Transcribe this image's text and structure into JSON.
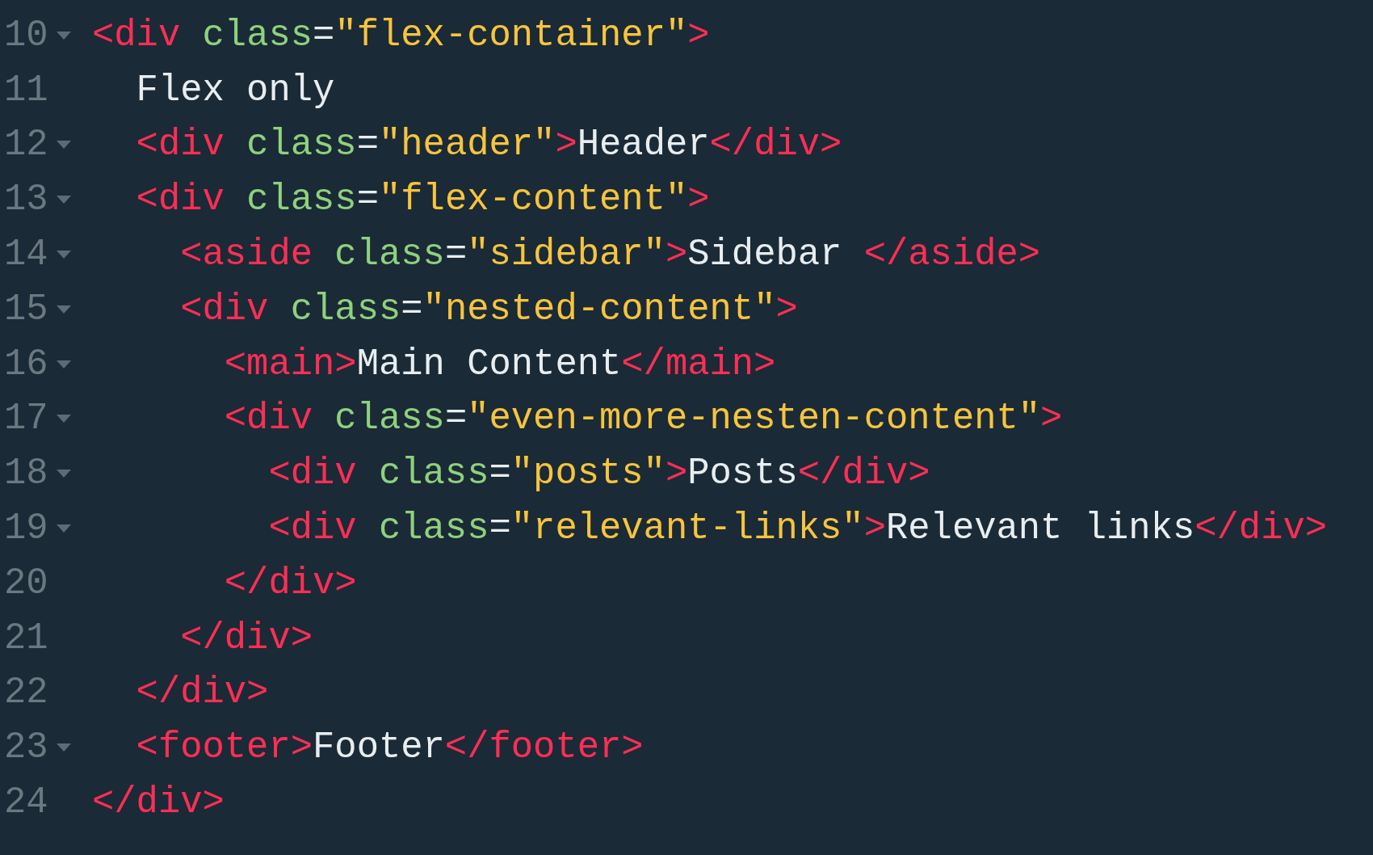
{
  "editor": {
    "lines": [
      {
        "number": "10",
        "foldable": true,
        "tokens": [
          {
            "kind": "tag",
            "text": "<div "
          },
          {
            "kind": "attr",
            "text": "class"
          },
          {
            "kind": "text",
            "text": "="
          },
          {
            "kind": "string",
            "text": "\"flex-container\""
          },
          {
            "kind": "tag",
            "text": ">"
          }
        ],
        "children": [
          {
            "number": "11",
            "foldable": false,
            "tokens": [
              {
                "kind": "text",
                "text": "Flex only"
              }
            ]
          },
          {
            "number": "12",
            "foldable": true,
            "tokens": [
              {
                "kind": "tag",
                "text": "<div "
              },
              {
                "kind": "attr",
                "text": "class"
              },
              {
                "kind": "text",
                "text": "="
              },
              {
                "kind": "string",
                "text": "\"header\""
              },
              {
                "kind": "tag",
                "text": ">"
              },
              {
                "kind": "text",
                "text": "Header"
              },
              {
                "kind": "tag",
                "text": "</div>"
              }
            ]
          },
          {
            "number": "13",
            "foldable": true,
            "tokens": [
              {
                "kind": "tag",
                "text": "<div "
              },
              {
                "kind": "attr",
                "text": "class"
              },
              {
                "kind": "text",
                "text": "="
              },
              {
                "kind": "string",
                "text": "\"flex-content\""
              },
              {
                "kind": "tag",
                "text": ">"
              }
            ],
            "children": [
              {
                "number": "14",
                "foldable": true,
                "tokens": [
                  {
                    "kind": "tag",
                    "text": "<aside "
                  },
                  {
                    "kind": "attr",
                    "text": "class"
                  },
                  {
                    "kind": "text",
                    "text": "="
                  },
                  {
                    "kind": "string",
                    "text": "\"sidebar\""
                  },
                  {
                    "kind": "tag",
                    "text": ">"
                  },
                  {
                    "kind": "text",
                    "text": "Sidebar "
                  },
                  {
                    "kind": "tag",
                    "text": "</aside>"
                  }
                ]
              },
              {
                "number": "15",
                "foldable": true,
                "tokens": [
                  {
                    "kind": "tag",
                    "text": "<div "
                  },
                  {
                    "kind": "attr",
                    "text": "class"
                  },
                  {
                    "kind": "text",
                    "text": "="
                  },
                  {
                    "kind": "string",
                    "text": "\"nested-content\""
                  },
                  {
                    "kind": "tag",
                    "text": ">"
                  }
                ],
                "children": [
                  {
                    "number": "16",
                    "foldable": true,
                    "tokens": [
                      {
                        "kind": "tag",
                        "text": "<main>"
                      },
                      {
                        "kind": "text",
                        "text": "Main Content"
                      },
                      {
                        "kind": "tag",
                        "text": "</main>"
                      }
                    ]
                  },
                  {
                    "number": "17",
                    "foldable": true,
                    "tokens": [
                      {
                        "kind": "tag",
                        "text": "<div "
                      },
                      {
                        "kind": "attr",
                        "text": "class"
                      },
                      {
                        "kind": "text",
                        "text": "="
                      },
                      {
                        "kind": "string",
                        "text": "\"even-more-nesten-content\""
                      },
                      {
                        "kind": "tag",
                        "text": ">"
                      }
                    ],
                    "children": [
                      {
                        "number": "18",
                        "foldable": true,
                        "tokens": [
                          {
                            "kind": "tag",
                            "text": "<div "
                          },
                          {
                            "kind": "attr",
                            "text": "class"
                          },
                          {
                            "kind": "text",
                            "text": "="
                          },
                          {
                            "kind": "string",
                            "text": "\"posts\""
                          },
                          {
                            "kind": "tag",
                            "text": ">"
                          },
                          {
                            "kind": "text",
                            "text": "Posts"
                          },
                          {
                            "kind": "tag",
                            "text": "</div>"
                          }
                        ]
                      },
                      {
                        "number": "19",
                        "foldable": true,
                        "tokens": [
                          {
                            "kind": "tag",
                            "text": "<div "
                          },
                          {
                            "kind": "attr",
                            "text": "class"
                          },
                          {
                            "kind": "text",
                            "text": "="
                          },
                          {
                            "kind": "string",
                            "text": "\"relevant-links\""
                          },
                          {
                            "kind": "tag",
                            "text": ">"
                          },
                          {
                            "kind": "text",
                            "text": "Relevant links"
                          },
                          {
                            "kind": "tag",
                            "text": "</div>"
                          }
                        ]
                      }
                    ]
                  },
                  {
                    "number": "20",
                    "foldable": false,
                    "tokens": [
                      {
                        "kind": "tag",
                        "text": "</div>"
                      }
                    ]
                  }
                ]
              },
              {
                "number": "21",
                "foldable": false,
                "tokens": [
                  {
                    "kind": "tag",
                    "text": "</div>"
                  }
                ]
              }
            ]
          },
          {
            "number": "22",
            "foldable": false,
            "tokens": [
              {
                "kind": "tag",
                "text": "</div>"
              }
            ]
          },
          {
            "number": "23",
            "foldable": true,
            "tokens": [
              {
                "kind": "tag",
                "text": "<footer>"
              },
              {
                "kind": "text",
                "text": "Footer"
              },
              {
                "kind": "tag",
                "text": "</footer>"
              }
            ]
          }
        ]
      },
      {
        "number": "24",
        "foldable": false,
        "tokens": [
          {
            "kind": "tag",
            "text": "</div>"
          }
        ]
      }
    ]
  }
}
